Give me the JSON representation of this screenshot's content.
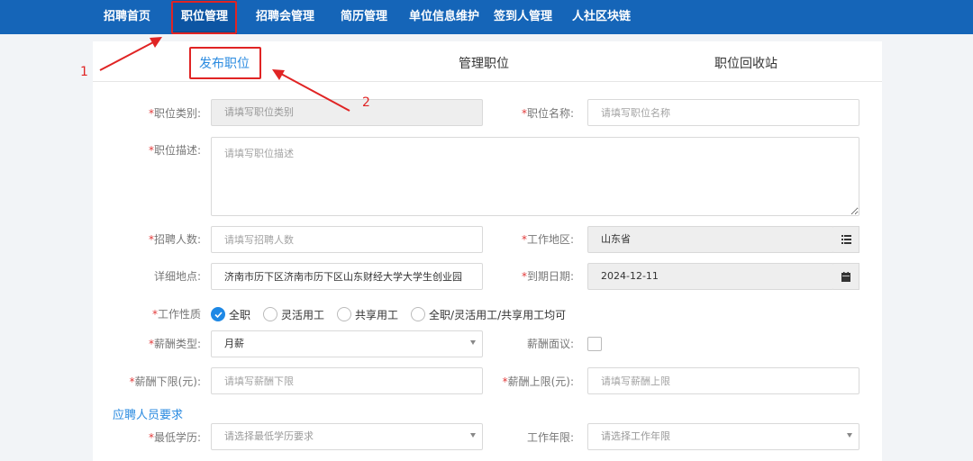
{
  "nav": {
    "items": [
      "招聘首页",
      "职位管理",
      "招聘会管理",
      "简历管理",
      "单位信息维护",
      "签到人管理",
      "人社区块链"
    ],
    "active_index": 1
  },
  "tabs": [
    "发布职位",
    "管理职位",
    "职位回收站"
  ],
  "form": {
    "category": {
      "label": "职位类别:",
      "placeholder": "请填写职位类别"
    },
    "name": {
      "label": "职位名称:",
      "placeholder": "请填写职位名称"
    },
    "description": {
      "label": "职位描述:",
      "placeholder": "请填写职位描述"
    },
    "headcount": {
      "label": "招聘人数:",
      "placeholder": "请填写招聘人数"
    },
    "region": {
      "label": "工作地区:",
      "value": "山东省"
    },
    "address": {
      "label": "详细地点:",
      "value": "济南市历下区济南市历下区山东财经大学大学生创业园"
    },
    "deadline": {
      "label": "到期日期:",
      "value": "2024-12-11"
    },
    "job_nature": {
      "label": "工作性质",
      "options": [
        "全职",
        "灵活用工",
        "共享用工",
        "全职/灵活用工/共享用工均可"
      ],
      "selected_index": 0
    },
    "salary_type": {
      "label": "薪酬类型:",
      "value": "月薪"
    },
    "salary_negotiable": {
      "label": "薪酬面议:",
      "checked": false
    },
    "salary_min": {
      "label": "薪酬下限(元):",
      "placeholder": "请填写薪酬下限"
    },
    "salary_max": {
      "label": "薪酬上限(元):",
      "placeholder": "请填写薪酬上限"
    }
  },
  "requirements": {
    "title": "应聘人员要求",
    "education": {
      "label": "最低学历:",
      "placeholder": "请选择最低学历要求"
    },
    "experience": {
      "label": "工作年限:",
      "placeholder": "请选择工作年限"
    }
  },
  "annotations": {
    "step1": "1",
    "step2": "2"
  },
  "colors": {
    "nav_bg": "#1565b8",
    "accent": "#2b8be0",
    "required": "#e23a3a",
    "annotation": "#e02424"
  }
}
